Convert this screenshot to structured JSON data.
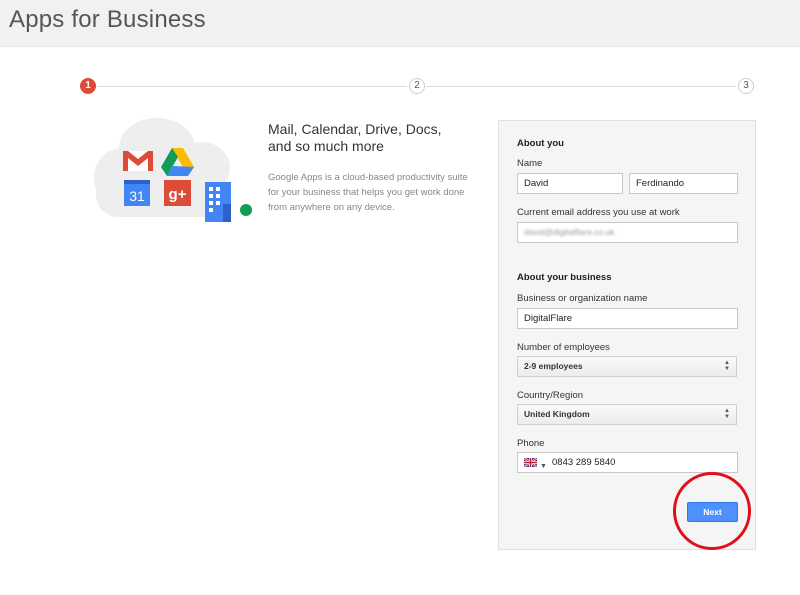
{
  "header": {
    "title": "Apps for Business"
  },
  "stepper": {
    "steps": [
      "1",
      "2",
      "3"
    ],
    "current_step": 1
  },
  "intro": {
    "title": "Mail, Calendar, Drive, Docs, and so much more",
    "description": "Google Apps is a cloud-based productivity suite for your business that helps you get work done from anywhere on any device."
  },
  "icons": {
    "calendar_number": "31",
    "gplus_text": "g+"
  },
  "form": {
    "about_you": {
      "title": "About you",
      "name_label": "Name",
      "first_name": "David",
      "last_name": "Ferdinando",
      "email_label": "Current email address you use at work",
      "email_value": "david@digitalflare.co.uk"
    },
    "about_business": {
      "title": "About your business",
      "org_label": "Business or organization name",
      "org_value": "DigitalFlare",
      "employees_label": "Number of employees",
      "employees_value": "2-9 employees",
      "country_label": "Country/Region",
      "country_value": "United Kingdom",
      "phone_label": "Phone",
      "phone_value": "0843 289 5840"
    },
    "next_label": "Next"
  },
  "colors": {
    "accent_blue": "#4d90fe",
    "step_active": "#dd4b39",
    "highlight": "#e0101a"
  }
}
